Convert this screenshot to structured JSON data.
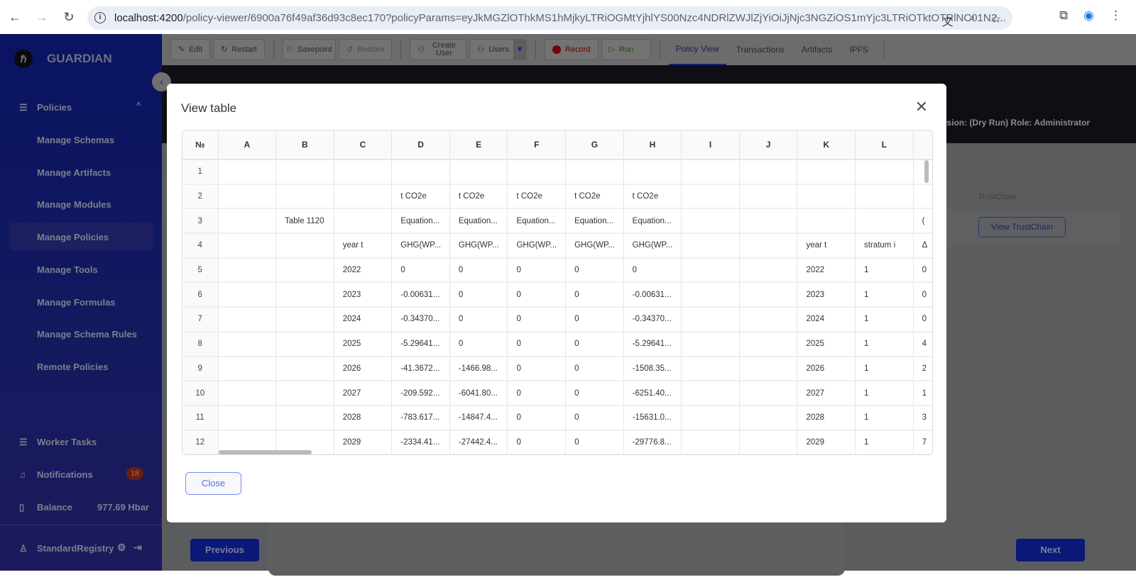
{
  "browser": {
    "url_host": "localhost:4200",
    "url_rest": "/policy-viewer/6900a76f49af36d93c8ec170?policyParams=eyJkMGZlOThkMS1hMjkyLTRiOGMtYjhlYS00Nzc4NDRlZWJlZjYiOiJjNjc3NGZiOS1mYjc3LTRiOTktOTRlNC01N2..."
  },
  "sidebar": {
    "brand": "GUARDIAN",
    "section": "Policies",
    "items": [
      "Manage Schemas",
      "Manage Artifacts",
      "Manage Modules",
      "Manage Policies",
      "Manage Tools",
      "Manage Formulas",
      "Manage Schema Rules",
      "Remote Policies"
    ],
    "worker_tasks": "Worker Tasks",
    "notifications": "Notifications",
    "notifications_count": "18",
    "balance_label": "Balance",
    "balance_value": "977.69 Hbar",
    "user": "StandardRegistry"
  },
  "toolbar": {
    "edit": "Edit",
    "restart": "Restart",
    "savepoint": "Savepoint",
    "restore": "Restore",
    "create_user": "Create User",
    "users": "Users",
    "record": "Record",
    "run": "Run",
    "tabs": [
      "Policy View",
      "Transactions",
      "Artifacts",
      "IPFS"
    ]
  },
  "header": {
    "version_role": "rsion: (Dry Run)   Role: Administrator"
  },
  "page": {
    "trustchain_header": "TrustChain",
    "view_trustchain": "View TrustChain",
    "previous": "Previous",
    "next": "Next"
  },
  "modal": {
    "title": "View table",
    "close": "Close",
    "num_header": "№",
    "columns": [
      "A",
      "B",
      "C",
      "D",
      "E",
      "F",
      "G",
      "H",
      "I",
      "J",
      "K",
      "L",
      ""
    ],
    "rows": [
      [
        "1",
        "",
        "",
        "",
        "",
        "",
        "",
        "",
        "",
        "",
        "",
        "",
        "",
        ""
      ],
      [
        "2",
        "",
        "",
        "",
        "t CO2e",
        "t CO2e",
        "t CO2e",
        "t CO2e",
        "t CO2e",
        "",
        "",
        "",
        "",
        ""
      ],
      [
        "3",
        "",
        "Table 1120",
        "",
        "Equation...",
        "Equation...",
        "Equation...",
        "Equation...",
        "Equation...",
        "",
        "",
        "",
        "",
        "("
      ],
      [
        "4",
        "",
        "",
        "year t",
        "GHG(WP...",
        "GHG(WP...",
        "GHG(WP...",
        "GHG(WP...",
        "GHG(WP...",
        "",
        "",
        "year t",
        "stratum i",
        "Δ"
      ],
      [
        "5",
        "",
        "",
        "2022",
        "0",
        "0",
        "0",
        "0",
        "0",
        "",
        "",
        "2022",
        "1",
        "0"
      ],
      [
        "6",
        "",
        "",
        "2023",
        "-0.00631...",
        "0",
        "0",
        "0",
        "-0.00631...",
        "",
        "",
        "2023",
        "1",
        "0"
      ],
      [
        "7",
        "",
        "",
        "2024",
        "-0.34370...",
        "0",
        "0",
        "0",
        "-0.34370...",
        "",
        "",
        "2024",
        "1",
        "0"
      ],
      [
        "8",
        "",
        "",
        "2025",
        "-5.29641...",
        "0",
        "0",
        "0",
        "-5.29641...",
        "",
        "",
        "2025",
        "1",
        "4"
      ],
      [
        "9",
        "",
        "",
        "2026",
        "-41.3672...",
        "-1466.98...",
        "0",
        "0",
        "-1508.35...",
        "",
        "",
        "2026",
        "1",
        "2"
      ],
      [
        "10",
        "",
        "",
        "2027",
        "-209.592...",
        "-6041.80...",
        "0",
        "0",
        "-6251.40...",
        "",
        "",
        "2027",
        "1",
        "1"
      ],
      [
        "11",
        "",
        "",
        "2028",
        "-783.617...",
        "-14847.4...",
        "0",
        "0",
        "-15631.0...",
        "",
        "",
        "2028",
        "1",
        "3"
      ],
      [
        "12",
        "",
        "",
        "2029",
        "-2334.41...",
        "-27442.4...",
        "0",
        "0",
        "-29776.8...",
        "",
        "",
        "2029",
        "1",
        "7"
      ]
    ]
  }
}
